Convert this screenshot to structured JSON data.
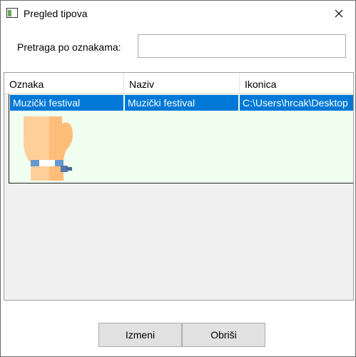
{
  "window": {
    "title": "Pregled tipova"
  },
  "search": {
    "label": "Pretraga po oznakama:",
    "value": "",
    "placeholder": ""
  },
  "grid": {
    "columns": [
      "Oznaka",
      "Naziv",
      "Ikonica"
    ],
    "rows": [
      {
        "oznaka": "Muzički festival",
        "naziv": "Muzički festival",
        "ikonica": "C:\\Users\\hrcak\\Desktop",
        "icon": "wristband-hand-icon",
        "selected": true
      }
    ]
  },
  "buttons": {
    "edit": "Izmeni",
    "delete": "Obriši"
  },
  "colors": {
    "selection": "#0078d7",
    "row_background": "#f0fff0",
    "grid_background": "#f0f0f0"
  }
}
